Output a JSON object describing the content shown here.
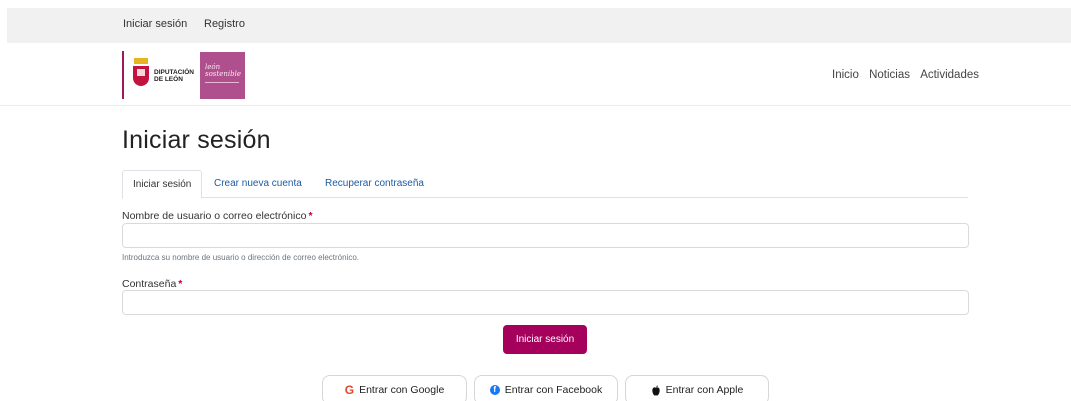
{
  "topbar": {
    "login": "Iniciar sesión",
    "register": "Registro"
  },
  "logos": {
    "dip_line1": "DIPUTACIÓN",
    "dip_line2": "DE LEÓN",
    "leon_line1": "león",
    "leon_line2": "sostenible"
  },
  "nav": {
    "home": "Inicio",
    "news": "Noticias",
    "activities": "Actividades"
  },
  "page_title": "Iniciar sesión",
  "tabs": [
    {
      "label": "Iniciar sesión",
      "active": true
    },
    {
      "label": "Crear nueva cuenta",
      "active": false
    },
    {
      "label": "Recuperar contraseña",
      "active": false
    }
  ],
  "form": {
    "username_label": "Nombre de usuario o correo electrónico",
    "required_mark": "*",
    "username_value": "",
    "username_help": "Introduzca su nombre de usuario o dirección de correo electrónico.",
    "password_label": "Contraseña",
    "password_value": "",
    "submit_label": "Iniciar sesión"
  },
  "social": {
    "google": {
      "label": "Entrar con Google",
      "icon": "google-icon"
    },
    "facebook": {
      "label": "Entrar con Facebook",
      "icon": "facebook-icon"
    },
    "apple": {
      "label": "Entrar con Apple",
      "icon": "apple-icon"
    }
  },
  "colors": {
    "brand": "#a5005c",
    "link": "#1e5aa0",
    "required": "#c0002a"
  }
}
